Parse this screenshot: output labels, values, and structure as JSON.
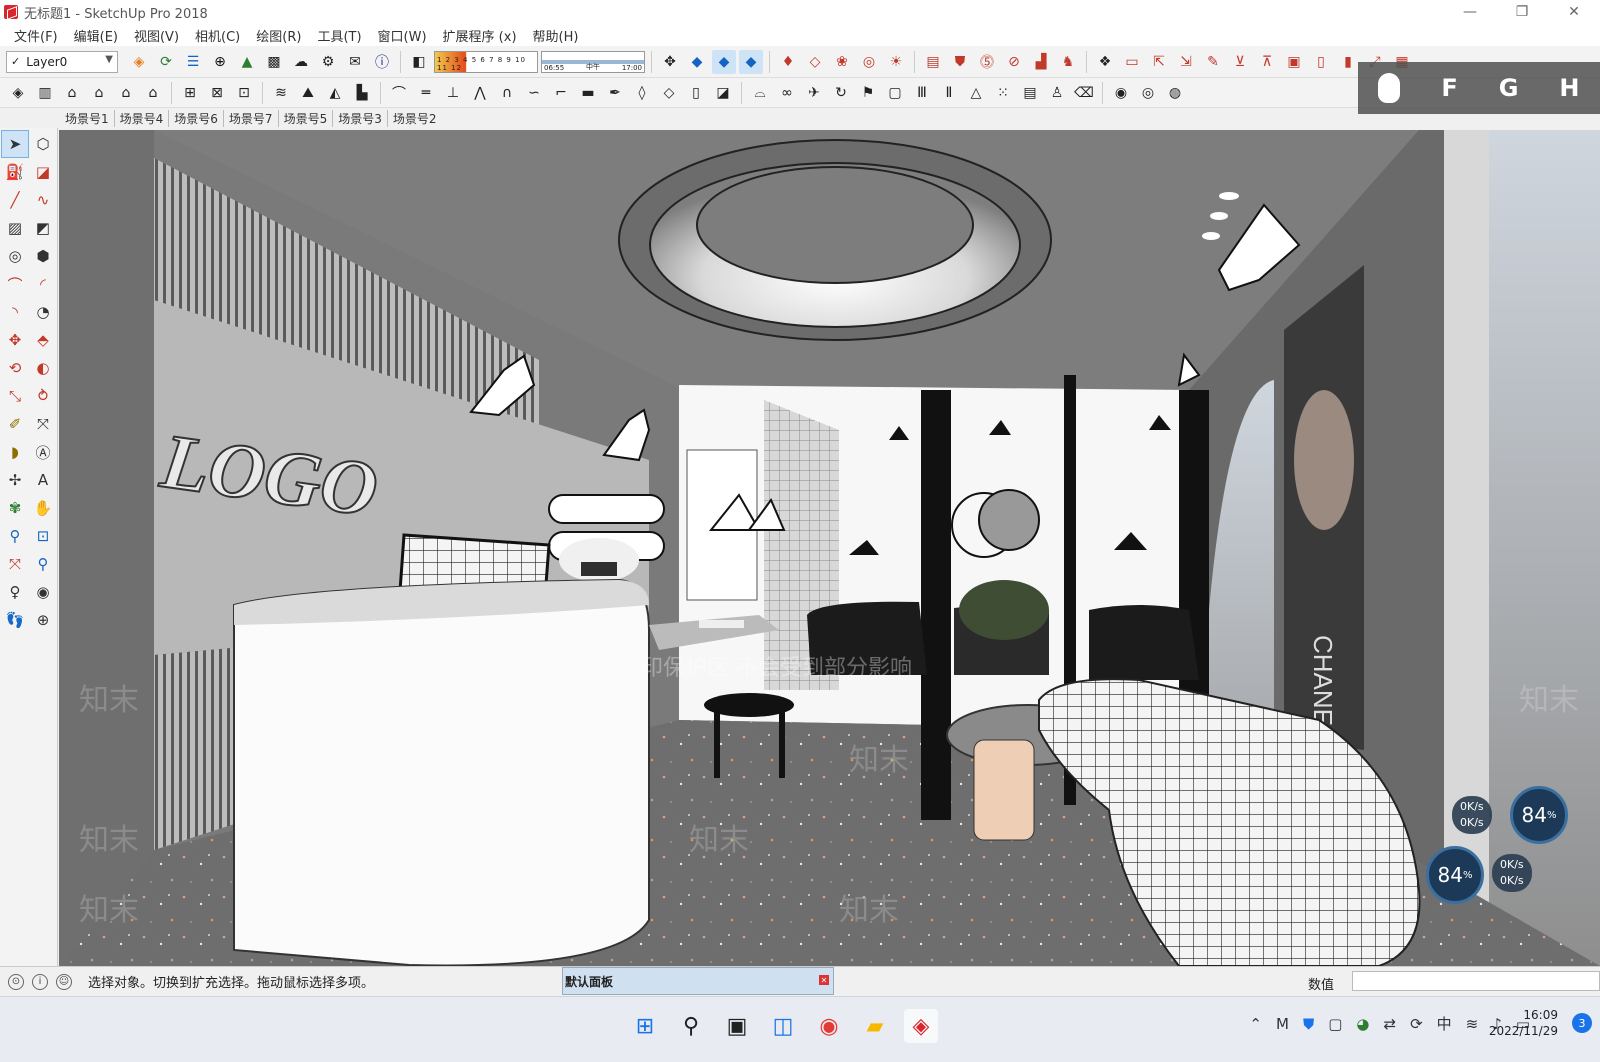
{
  "window": {
    "title": "无标题1 - SketchUp Pro 2018",
    "minimize": "—",
    "restore": "❐",
    "close": "✕"
  },
  "menu": [
    "文件(F)",
    "编辑(E)",
    "视图(V)",
    "相机(C)",
    "绘图(R)",
    "工具(T)",
    "窗口(W)",
    "扩展程序 (x)",
    "帮助(H)"
  ],
  "toolbar": {
    "layer": "Layer0",
    "shadow_months": "1 2 3 4 5 6 7 8 9 10 11 12",
    "time_start": "06:55",
    "time_mid": "中午",
    "time_end": "17:00"
  },
  "scenes": [
    "场景号1",
    "场景号4",
    "场景号6",
    "场景号7",
    "场景号5",
    "场景号3",
    "场景号2"
  ],
  "overlay_keys": [
    "F",
    "G",
    "H"
  ],
  "viewport": {
    "logo_text": "LOGO",
    "watermark": "水印保护区 不会受到部分影响",
    "watermark_brand": "知末",
    "poster_text": "CHANEL"
  },
  "netmon": {
    "up": "0K/s",
    "down": "0K/s",
    "percent": "84",
    "percent_unit": "%"
  },
  "status": {
    "message": "选择对象。切换到扩充选择。拖动鼠标选择多项。",
    "panel": "默认面板",
    "measurements_label": "数值"
  },
  "taskbar": {
    "ime": "中",
    "time": "16:09",
    "date": "2022/11/29",
    "notifications": "3"
  },
  "colors": {
    "accent": "#d8262c",
    "selection": "#cfe3f7",
    "panel": "#cfe0f1"
  }
}
